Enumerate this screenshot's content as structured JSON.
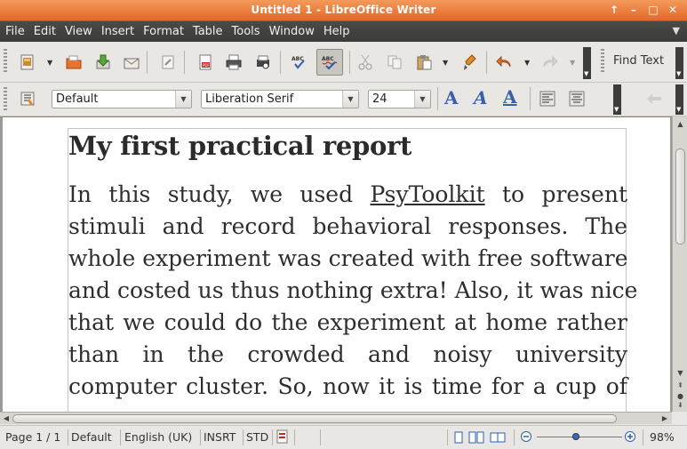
{
  "window": {
    "title": "Untitled 1 - LibreOffice Writer",
    "controls": [
      "↑",
      "–",
      "□",
      "✕"
    ]
  },
  "menu": {
    "items": [
      "File",
      "Edit",
      "View",
      "Insert",
      "Format",
      "Table",
      "Tools",
      "Window",
      "Help"
    ],
    "overflow_icon": "chevron-down-icon"
  },
  "toolbar1": {
    "find_text": "Find Text",
    "icons": [
      "new-document-icon",
      "open-folder-icon",
      "save-icon",
      "email-icon",
      "edit-file-icon",
      "export-pdf-icon",
      "print-icon",
      "print-preview-icon",
      "spellcheck-icon",
      "autospellcheck-icon",
      "cut-icon",
      "copy-icon",
      "paste-icon",
      "clone-formatting-icon",
      "undo-icon",
      "redo-icon"
    ]
  },
  "toolbar2": {
    "paragraph_style": "Default",
    "font_name": "Liberation Serif",
    "font_size": "24",
    "style_buttons": [
      "A",
      "A",
      "A"
    ]
  },
  "document": {
    "heading": "My first practical report",
    "paragraph_lines": [
      [
        "In this study, we used ",
        "PsyToolkit",
        " to present"
      ],
      [
        "stimuli and record behavioral responses. The"
      ],
      [
        "whole experiment was created with free software"
      ],
      [
        "and costed us thus nothing extra! Also, it was nice"
      ],
      [
        "that we could do the experiment at home rather"
      ],
      [
        "than in the crowded and noisy university"
      ],
      [
        "computer cluster. So, now it is time for a cup of"
      ]
    ]
  },
  "statusbar": {
    "page": "Page 1 / 1",
    "page_style": "Default",
    "language": "English (UK)",
    "insert_mode": "INSRT",
    "selection_mode": "STD",
    "zoom": "98%"
  }
}
